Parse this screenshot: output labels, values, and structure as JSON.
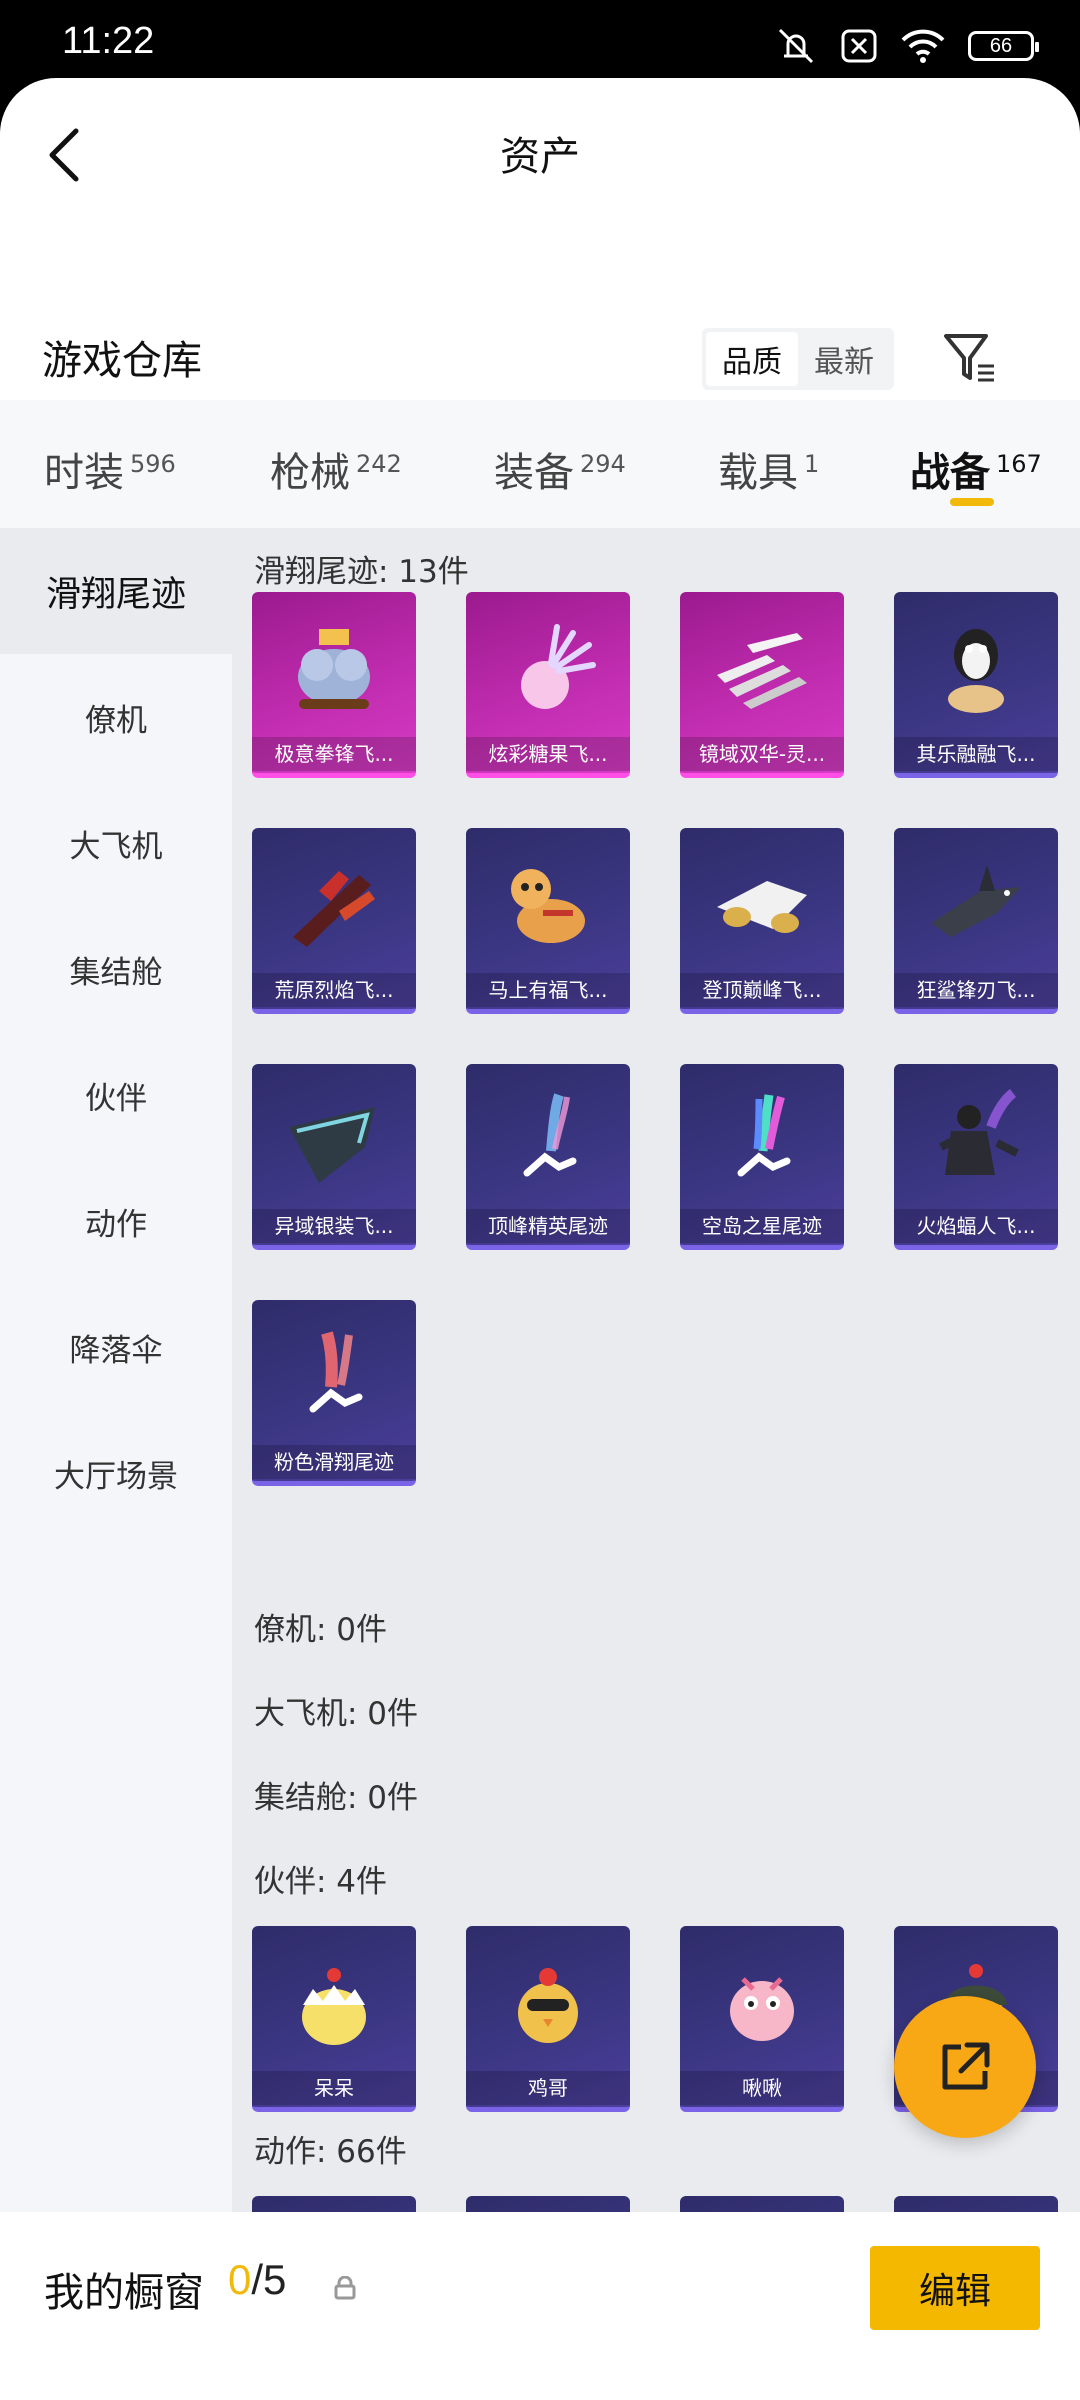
{
  "status_bar": {
    "time": "11:22",
    "battery": "66"
  },
  "header": {
    "title": "资产"
  },
  "warehouse": {
    "title": "游戏仓库",
    "sort_options": [
      "品质",
      "最新"
    ],
    "active_sort": "品质"
  },
  "category_tabs": [
    {
      "label": "时装",
      "count": "596"
    },
    {
      "label": "枪械",
      "count": "242"
    },
    {
      "label": "装备",
      "count": "294"
    },
    {
      "label": "载具",
      "count": "1"
    },
    {
      "label": "战备",
      "count": "167",
      "active": true
    }
  ],
  "sidebar": {
    "items": [
      "滑翔尾迹",
      "僚机",
      "大飞机",
      "集结舱",
      "伙伴",
      "动作",
      "降落伞",
      "大厅场景"
    ],
    "active": "滑翔尾迹"
  },
  "sections": {
    "trail": {
      "title": "滑翔尾迹: 13件",
      "items": [
        {
          "name": "极意拳锋飞...",
          "quality": "pink",
          "icon": "elephant-glider-icon"
        },
        {
          "name": "炫彩糖果飞...",
          "quality": "pink",
          "icon": "candy-glider-icon"
        },
        {
          "name": "镜域双华-灵...",
          "quality": "pink",
          "icon": "blade-wings-icon"
        },
        {
          "name": "其乐融融飞...",
          "quality": "purple",
          "icon": "penguin-glider-icon"
        },
        {
          "name": "荒原烈焰飞...",
          "quality": "purple",
          "icon": "flame-glider-icon"
        },
        {
          "name": "马上有福飞...",
          "quality": "purple",
          "icon": "horse-glider-icon"
        },
        {
          "name": "登顶巅峰飞...",
          "quality": "purple",
          "icon": "jet-glider-icon"
        },
        {
          "name": "狂鲨锋刃飞...",
          "quality": "purple",
          "icon": "shark-glider-icon"
        },
        {
          "name": "异域银装飞...",
          "quality": "purple",
          "icon": "silver-glider-icon"
        },
        {
          "name": "顶峰精英尾迹",
          "quality": "purple",
          "icon": "skydiver-trail-icon"
        },
        {
          "name": "空岛之星尾迹",
          "quality": "purple",
          "icon": "rainbow-trail-icon"
        },
        {
          "name": "火焰蝠人飞...",
          "quality": "purple",
          "icon": "batman-glider-icon"
        },
        {
          "name": "粉色滑翔尾迹",
          "quality": "purple",
          "icon": "pink-trail-icon"
        }
      ]
    },
    "wingman": {
      "title": "僚机: 0件"
    },
    "airplane": {
      "title": "大飞机: 0件"
    },
    "pod": {
      "title": "集结舱: 0件"
    },
    "partner": {
      "title": "伙伴: 4件",
      "items": [
        {
          "name": "呆呆",
          "icon": "chick-egg-icon"
        },
        {
          "name": "鸡哥",
          "icon": "rooster-icon"
        },
        {
          "name": "啾啾",
          "icon": "pink-bird-icon"
        },
        {
          "name": "",
          "icon": "helmet-chick-icon"
        }
      ]
    },
    "action": {
      "title": "动作: 66件"
    }
  },
  "bottom_bar": {
    "label": "我的橱窗",
    "current": "0",
    "total": "/5",
    "edit_label": "编辑"
  },
  "colors": {
    "accent": "#f5b800",
    "pink_quality": "#c02caf",
    "purple_quality": "#3b3682"
  }
}
